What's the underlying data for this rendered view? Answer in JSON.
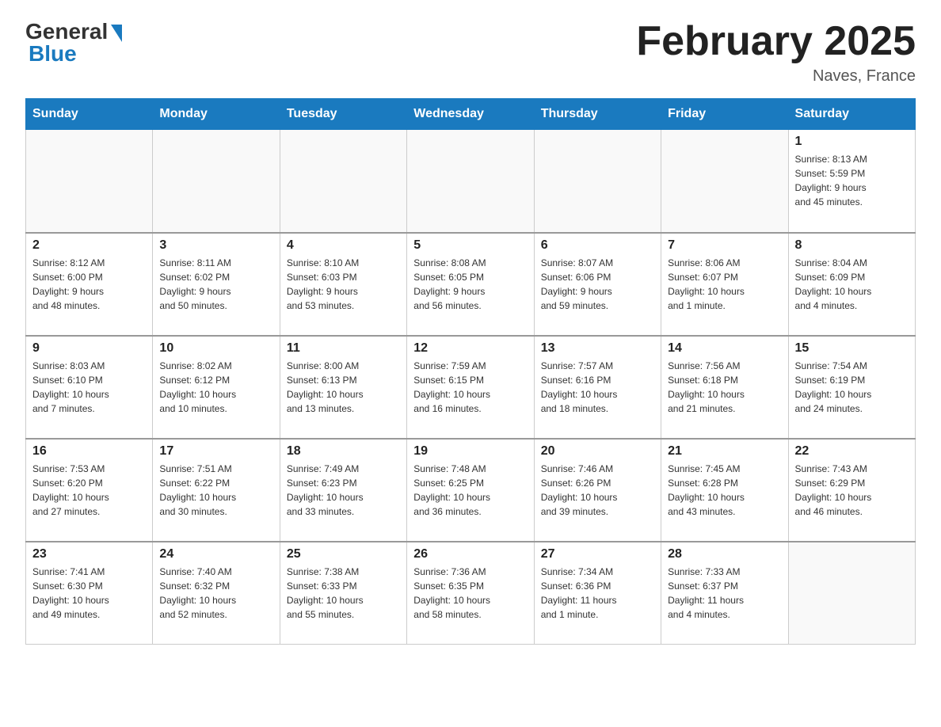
{
  "header": {
    "logo_general": "General",
    "logo_blue": "Blue",
    "month_title": "February 2025",
    "location": "Naves, France"
  },
  "days_of_week": [
    "Sunday",
    "Monday",
    "Tuesday",
    "Wednesday",
    "Thursday",
    "Friday",
    "Saturday"
  ],
  "weeks": [
    {
      "days": [
        {
          "number": "",
          "info": ""
        },
        {
          "number": "",
          "info": ""
        },
        {
          "number": "",
          "info": ""
        },
        {
          "number": "",
          "info": ""
        },
        {
          "number": "",
          "info": ""
        },
        {
          "number": "",
          "info": ""
        },
        {
          "number": "1",
          "info": "Sunrise: 8:13 AM\nSunset: 5:59 PM\nDaylight: 9 hours\nand 45 minutes."
        }
      ]
    },
    {
      "days": [
        {
          "number": "2",
          "info": "Sunrise: 8:12 AM\nSunset: 6:00 PM\nDaylight: 9 hours\nand 48 minutes."
        },
        {
          "number": "3",
          "info": "Sunrise: 8:11 AM\nSunset: 6:02 PM\nDaylight: 9 hours\nand 50 minutes."
        },
        {
          "number": "4",
          "info": "Sunrise: 8:10 AM\nSunset: 6:03 PM\nDaylight: 9 hours\nand 53 minutes."
        },
        {
          "number": "5",
          "info": "Sunrise: 8:08 AM\nSunset: 6:05 PM\nDaylight: 9 hours\nand 56 minutes."
        },
        {
          "number": "6",
          "info": "Sunrise: 8:07 AM\nSunset: 6:06 PM\nDaylight: 9 hours\nand 59 minutes."
        },
        {
          "number": "7",
          "info": "Sunrise: 8:06 AM\nSunset: 6:07 PM\nDaylight: 10 hours\nand 1 minute."
        },
        {
          "number": "8",
          "info": "Sunrise: 8:04 AM\nSunset: 6:09 PM\nDaylight: 10 hours\nand 4 minutes."
        }
      ]
    },
    {
      "days": [
        {
          "number": "9",
          "info": "Sunrise: 8:03 AM\nSunset: 6:10 PM\nDaylight: 10 hours\nand 7 minutes."
        },
        {
          "number": "10",
          "info": "Sunrise: 8:02 AM\nSunset: 6:12 PM\nDaylight: 10 hours\nand 10 minutes."
        },
        {
          "number": "11",
          "info": "Sunrise: 8:00 AM\nSunset: 6:13 PM\nDaylight: 10 hours\nand 13 minutes."
        },
        {
          "number": "12",
          "info": "Sunrise: 7:59 AM\nSunset: 6:15 PM\nDaylight: 10 hours\nand 16 minutes."
        },
        {
          "number": "13",
          "info": "Sunrise: 7:57 AM\nSunset: 6:16 PM\nDaylight: 10 hours\nand 18 minutes."
        },
        {
          "number": "14",
          "info": "Sunrise: 7:56 AM\nSunset: 6:18 PM\nDaylight: 10 hours\nand 21 minutes."
        },
        {
          "number": "15",
          "info": "Sunrise: 7:54 AM\nSunset: 6:19 PM\nDaylight: 10 hours\nand 24 minutes."
        }
      ]
    },
    {
      "days": [
        {
          "number": "16",
          "info": "Sunrise: 7:53 AM\nSunset: 6:20 PM\nDaylight: 10 hours\nand 27 minutes."
        },
        {
          "number": "17",
          "info": "Sunrise: 7:51 AM\nSunset: 6:22 PM\nDaylight: 10 hours\nand 30 minutes."
        },
        {
          "number": "18",
          "info": "Sunrise: 7:49 AM\nSunset: 6:23 PM\nDaylight: 10 hours\nand 33 minutes."
        },
        {
          "number": "19",
          "info": "Sunrise: 7:48 AM\nSunset: 6:25 PM\nDaylight: 10 hours\nand 36 minutes."
        },
        {
          "number": "20",
          "info": "Sunrise: 7:46 AM\nSunset: 6:26 PM\nDaylight: 10 hours\nand 39 minutes."
        },
        {
          "number": "21",
          "info": "Sunrise: 7:45 AM\nSunset: 6:28 PM\nDaylight: 10 hours\nand 43 minutes."
        },
        {
          "number": "22",
          "info": "Sunrise: 7:43 AM\nSunset: 6:29 PM\nDaylight: 10 hours\nand 46 minutes."
        }
      ]
    },
    {
      "days": [
        {
          "number": "23",
          "info": "Sunrise: 7:41 AM\nSunset: 6:30 PM\nDaylight: 10 hours\nand 49 minutes."
        },
        {
          "number": "24",
          "info": "Sunrise: 7:40 AM\nSunset: 6:32 PM\nDaylight: 10 hours\nand 52 minutes."
        },
        {
          "number": "25",
          "info": "Sunrise: 7:38 AM\nSunset: 6:33 PM\nDaylight: 10 hours\nand 55 minutes."
        },
        {
          "number": "26",
          "info": "Sunrise: 7:36 AM\nSunset: 6:35 PM\nDaylight: 10 hours\nand 58 minutes."
        },
        {
          "number": "27",
          "info": "Sunrise: 7:34 AM\nSunset: 6:36 PM\nDaylight: 11 hours\nand 1 minute."
        },
        {
          "number": "28",
          "info": "Sunrise: 7:33 AM\nSunset: 6:37 PM\nDaylight: 11 hours\nand 4 minutes."
        },
        {
          "number": "",
          "info": ""
        }
      ]
    }
  ]
}
